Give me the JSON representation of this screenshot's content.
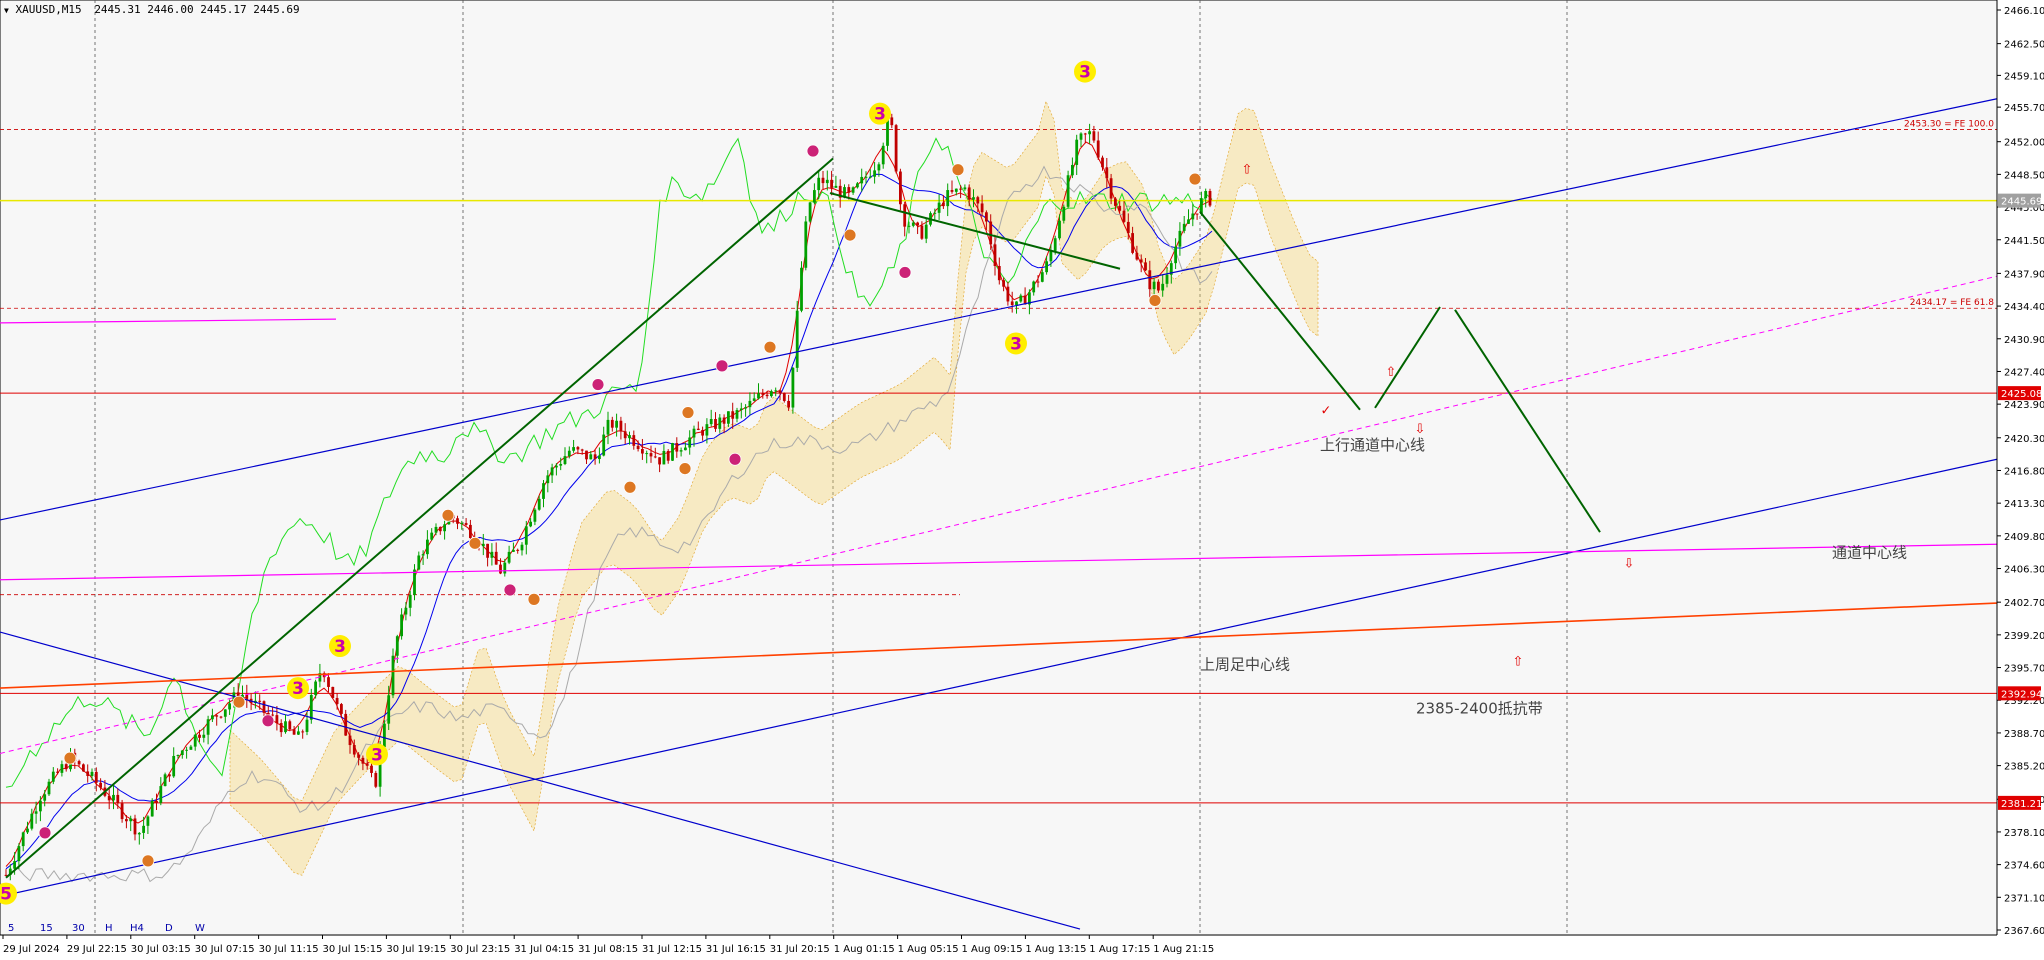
{
  "header": {
    "symbol": "XAUUSD,M15",
    "ohlc": "2445.31 2446.00 2445.17 2445.69"
  },
  "chart_data": {
    "type": "candlestick",
    "ylim": [
      2366.0,
      2467.0
    ],
    "price_ticks": [
      "2466.10",
      "2462.50",
      "2459.10",
      "2455.70",
      "2452.00",
      "2448.50",
      "2445.00",
      "2441.50",
      "2437.90",
      "2434.40",
      "2430.90",
      "2427.40",
      "2423.90",
      "2420.30",
      "2416.80",
      "2413.30",
      "2409.80",
      "2406.30",
      "2402.70",
      "2399.20",
      "2395.70",
      "2392.20",
      "2388.70",
      "2385.20",
      "2381.60",
      "2378.10",
      "2374.60",
      "2371.10",
      "2367.60"
    ],
    "time_ticks": [
      "29 Jul 2024",
      "29 Jul 22:15",
      "30 Jul 03:15",
      "30 Jul 07:15",
      "30 Jul 11:15",
      "30 Jul 15:15",
      "30 Jul 19:15",
      "30 Jul 23:15",
      "31 Jul 04:15",
      "31 Jul 08:15",
      "31 Jul 12:15",
      "31 Jul 16:15",
      "31 Jul 20:15",
      "1 Aug 01:15",
      "1 Aug 05:15",
      "1 Aug 09:15",
      "1 Aug 13:15",
      "1 Aug 17:15",
      "1 Aug 21:15"
    ],
    "timeframes": [
      "5",
      "15",
      "30",
      "H",
      "H4",
      "D",
      "W"
    ],
    "price_markers": [
      {
        "label": "2445.69",
        "price": 2445.69,
        "bg": "#a0a0a0",
        "fg": "#ffffff"
      },
      {
        "label": "2425.08",
        "price": 2425.08,
        "bg": "#e00000",
        "fg": "#ffffff"
      },
      {
        "label": "2392.94",
        "price": 2392.94,
        "bg": "#e00000",
        "fg": "#ffffff"
      },
      {
        "label": "2381.21",
        "price": 2381.21,
        "bg": "#e00000",
        "fg": "#ffffff"
      }
    ],
    "fib_labels": [
      {
        "text": "2453.30 = FE 100.0",
        "price": 2453.3
      },
      {
        "text": "2434.17 = FE 61.8",
        "price": 2434.17
      }
    ],
    "annotations": [
      {
        "text": "上行通道中心线",
        "price": 2419.0
      },
      {
        "text": "通道中心线",
        "price": 2407.5
      },
      {
        "text": "上周足中心线",
        "price": 2395.5
      },
      {
        "text": "2385-2400抵抗带",
        "price": 2390.8
      }
    ],
    "wave_labels": [
      "3",
      "3",
      "3",
      "3",
      "3",
      "3",
      "5"
    ],
    "colors": {
      "background": "#f7f7f7",
      "bull": "#00a000",
      "bear": "#c00000",
      "channel": "#0000cc",
      "support": "#e00000",
      "center_line": "#ff00ff",
      "weekly_line": "#ff4000",
      "current_price": "#e8e800",
      "projection": "#006400",
      "wave_label_bg": "#ffee00"
    }
  }
}
